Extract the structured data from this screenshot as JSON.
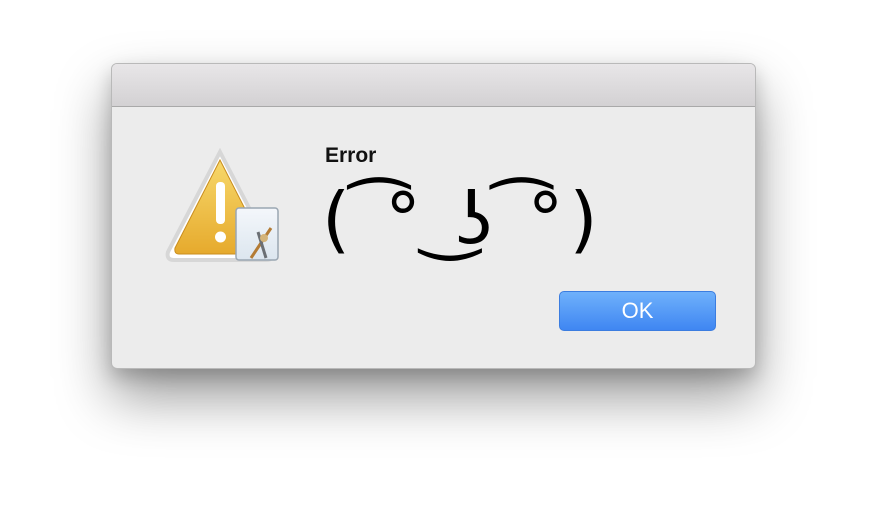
{
  "dialog": {
    "icon": "warning-app-icon",
    "title": "Error",
    "message": "( ͡° ͜ʖ ͡°)",
    "ok_label": "OK"
  },
  "colors": {
    "dialog_bg": "#ececec",
    "button_blue": "#4a90f5",
    "warning_yellow": "#f2c14c"
  }
}
